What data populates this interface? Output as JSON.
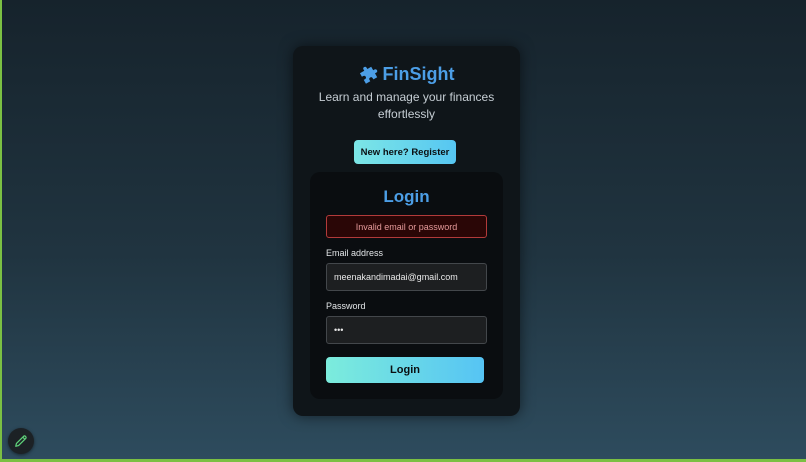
{
  "brand": {
    "name": "FinSight",
    "tagline": "Learn and manage your finances effortlessly",
    "icon": "puzzle-piece-icon",
    "color": "#4c9ee6"
  },
  "register_button": {
    "label": "New here? Register"
  },
  "login": {
    "title": "Login",
    "error_message": "Invalid email or password",
    "email": {
      "label": "Email address",
      "value": "meenakandimadai@gmail.com"
    },
    "password": {
      "label": "Password",
      "value": "•••"
    },
    "submit_label": "Login"
  },
  "floating_button": {
    "icon": "pencil-icon",
    "color": "#5fd37a"
  },
  "colors": {
    "accent_gradient_start": "#7ce6e6",
    "accent_gradient_end": "#56c6f2",
    "error_border": "#b23a3a",
    "error_text": "#e59a9a",
    "card_background": "#0f1519"
  }
}
